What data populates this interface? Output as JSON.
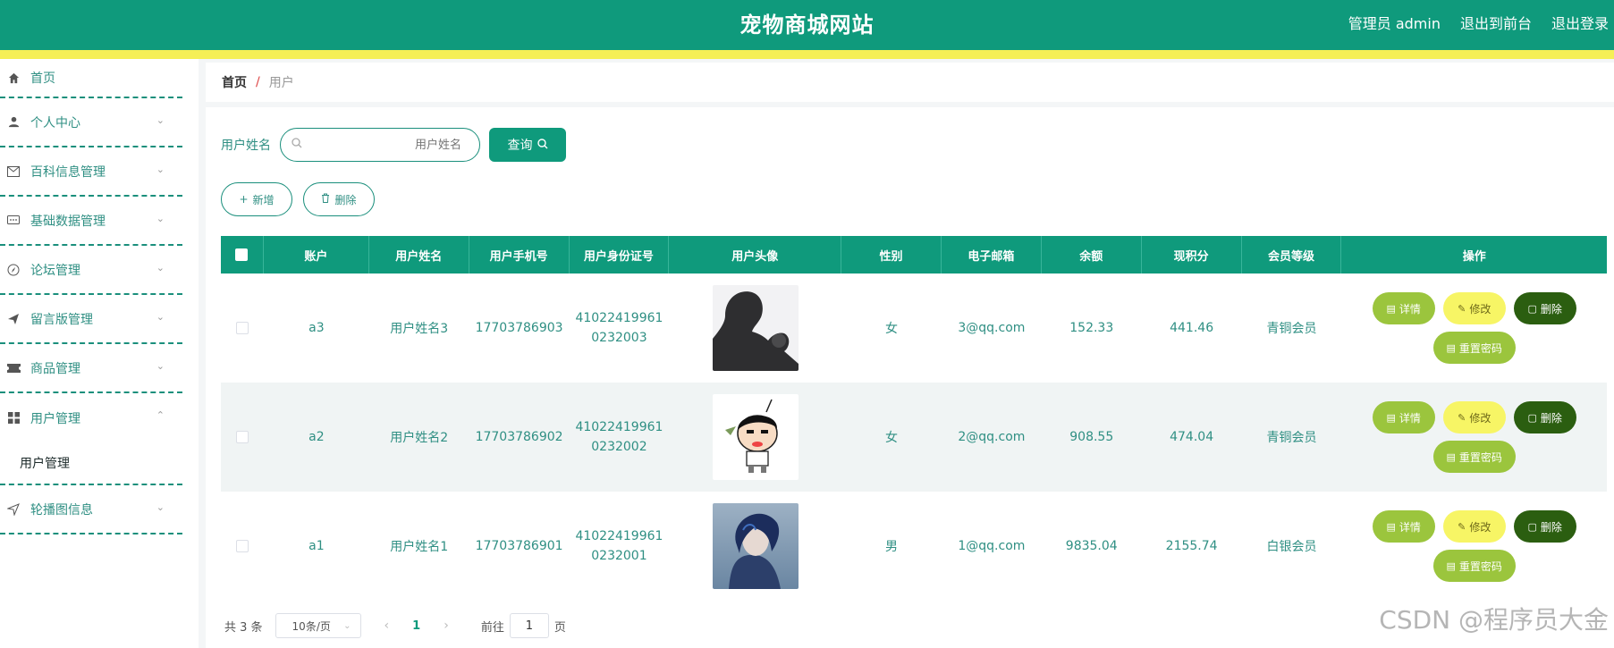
{
  "header": {
    "title": "宠物商城网站",
    "links": [
      "管理员 admin",
      "退出到前台",
      "退出登录"
    ]
  },
  "sidebar": {
    "items": [
      {
        "label": "首页",
        "icon": "home-icon",
        "chevron": false
      },
      {
        "label": "个人中心",
        "icon": "user-icon",
        "chevron": true
      },
      {
        "label": "百科信息管理",
        "icon": "mail-icon",
        "chevron": true
      },
      {
        "label": "基础数据管理",
        "icon": "chat-icon",
        "chevron": true
      },
      {
        "label": "论坛管理",
        "icon": "compass-icon",
        "chevron": true
      },
      {
        "label": "留言版管理",
        "icon": "send-icon",
        "chevron": true
      },
      {
        "label": "商品管理",
        "icon": "ticket-icon",
        "chevron": true
      },
      {
        "label": "用户管理",
        "icon": "grid-icon",
        "chevron": "up"
      },
      {
        "label": "轮播图信息",
        "icon": "navigation-icon",
        "chevron": true
      }
    ],
    "submenu_label": "用户管理"
  },
  "breadcrumb": {
    "home": "首页",
    "separator": "/",
    "current": "用户"
  },
  "search": {
    "label": "用户姓名",
    "placeholder": "用户姓名",
    "button": "查询"
  },
  "actions": {
    "add": "新增",
    "delete": "删除"
  },
  "table": {
    "headers": [
      "账户",
      "用户姓名",
      "用户手机号",
      "用户身份证号",
      "用户头像",
      "性别",
      "电子邮箱",
      "余额",
      "现积分",
      "会员等级",
      "操作"
    ],
    "rows": [
      {
        "account": "a3",
        "name": "用户姓名3",
        "phone": "17703786903",
        "id_line1": "41022419961",
        "id_line2": "0232003",
        "avatar": "avatar-dark-silhouette",
        "gender": "女",
        "email": "3@qq.com",
        "balance": "152.33",
        "points": "441.46",
        "level": "青铜会员"
      },
      {
        "account": "a2",
        "name": "用户姓名2",
        "phone": "17703786902",
        "id_line1": "41022419961",
        "id_line2": "0232002",
        "avatar": "avatar-cartoon",
        "gender": "女",
        "email": "2@qq.com",
        "balance": "908.55",
        "points": "474.04",
        "level": "青铜会员"
      },
      {
        "account": "a1",
        "name": "用户姓名1",
        "phone": "17703786901",
        "id_line1": "41022419961",
        "id_line2": "0232001",
        "avatar": "avatar-blue-hair",
        "gender": "男",
        "email": "1@qq.com",
        "balance": "9835.04",
        "points": "2155.74",
        "level": "白银会员"
      }
    ],
    "ops": {
      "detail": "详情",
      "edit": "修改",
      "delete": "删除",
      "reset": "重置密码"
    }
  },
  "pagination": {
    "total": "共 3 条",
    "page_size": "10条/页",
    "current_page": "1",
    "goto_label": "前往",
    "goto_value": "1",
    "page_suffix": "页"
  },
  "watermark": "CSDN @程序员大金",
  "colors": {
    "primary": "#0f9a7c",
    "accent_bar": "#f5ef56",
    "detail": "#9bc53d",
    "edit": "#f7f565",
    "delete": "#2b5e10"
  }
}
